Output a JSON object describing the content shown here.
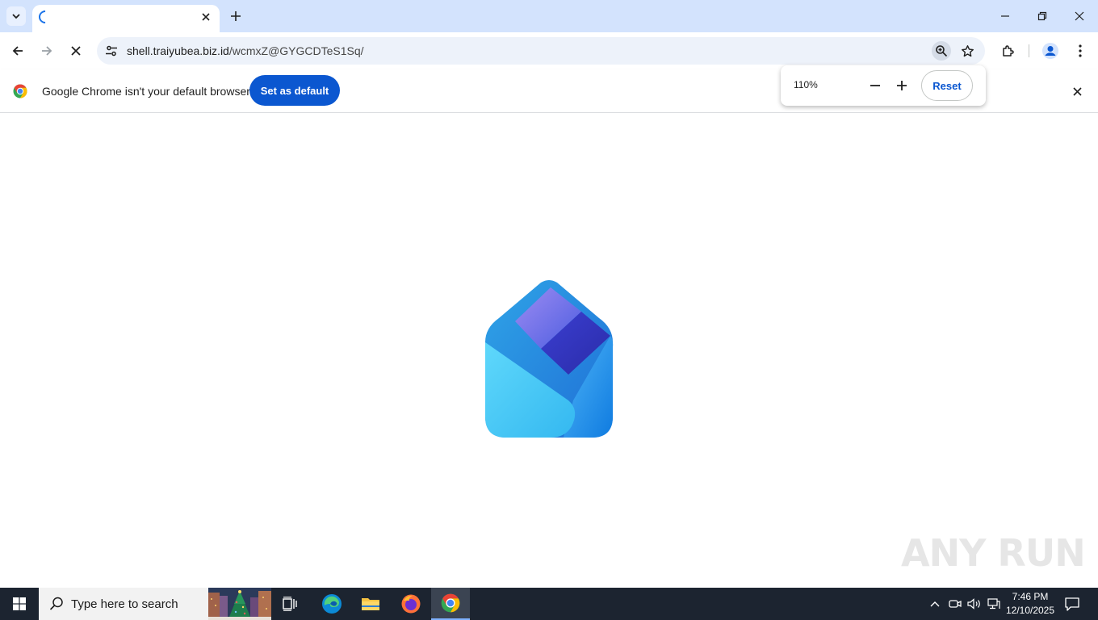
{
  "browser": {
    "tab_title": "",
    "url_host": "shell.traiyubea.biz.id",
    "url_path": "/wcmxZ@GYGCDTeS1Sq/"
  },
  "infobar": {
    "message": "Google Chrome isn't your default browser",
    "set_default_label": "Set as default"
  },
  "zoom_bubble": {
    "level": "110%",
    "reset_label": "Reset"
  },
  "watermark": {
    "text": "ANY RUN"
  },
  "taskbar": {
    "search_placeholder": "Type here to search",
    "time": "7:46 PM",
    "date": "12/10/2025"
  },
  "colors": {
    "accent": "#0b57d0",
    "tabstrip": "#d3e3fd",
    "taskbar": "#1c2430"
  }
}
